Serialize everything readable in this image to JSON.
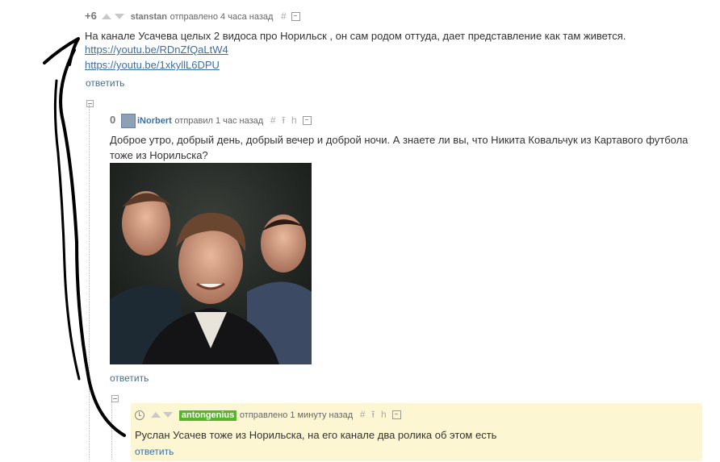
{
  "comment1": {
    "rating": "+6",
    "author": "stanstan",
    "meta": "отправлено 4 часа назад",
    "text": "На канале Усачева целых 2 видоса про Норильск , он сам родом оттуда, дает представление как там живется.",
    "links": [
      "https://youtu.be/RDnZfQaLtW4",
      "https://youtu.be/1xkyllL6DPU"
    ],
    "reply": "ответить"
  },
  "comment2": {
    "rating": "0",
    "author": "iNorbert",
    "meta": "отправил 1 час назад",
    "text_line1": "Доброе утро, добрый день, добрый вечер и доброй ночи. А знаете ли вы, что Никита Ковальчук из Картавого футбола",
    "text_line2": "тоже из Норильска?",
    "reply": "ответить"
  },
  "comment3": {
    "author": "antongenius",
    "meta": "отправлено 1 минуту назад",
    "text": "Руслан Усачев тоже из Норильска, на его канале два ролика об этом есть",
    "reply": "ответить"
  },
  "icons": {
    "hash": "#",
    "parent": "⭱",
    "branch": "h"
  },
  "colors": {
    "link": "#3b6fa0",
    "highlight_bg": "#fdf6d3",
    "author_badge": "#57b52a"
  }
}
